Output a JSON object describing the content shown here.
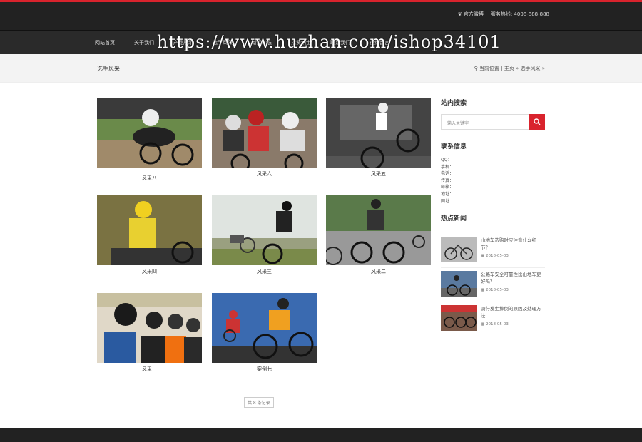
{
  "topbar": {
    "weibo": "官方微博",
    "hotline": "服务热线: 4008-888-888"
  },
  "nav": {
    "items": [
      "网站首页",
      "关于我们",
      "产品展示",
      "选手风采",
      "新闻动态",
      "招贤纳士",
      "联系我们",
      "在线留言"
    ]
  },
  "watermark": "https://www.huzhan.com/ishop34101",
  "titlebar": {
    "page_title": "选手风采",
    "location_label": "当前位置",
    "breadcrumb": "主页 » 选手风采 »"
  },
  "gallery": [
    {
      "caption": "风采八"
    },
    {
      "caption": "风采六"
    },
    {
      "caption": "风采五"
    },
    {
      "caption": "风采四"
    },
    {
      "caption": "风采三"
    },
    {
      "caption": "风采二"
    },
    {
      "caption": "风采一"
    },
    {
      "caption": "案例七"
    }
  ],
  "pagination": {
    "text": "共 8 条记录"
  },
  "sidebar": {
    "search_title": "站内搜索",
    "search_placeholder": "输入关键字",
    "contact_title": "联系信息",
    "contact_lines": [
      "QQ：",
      "手机：",
      "电话：",
      "传真：",
      "邮箱：",
      "地址：",
      "网址："
    ],
    "news_title": "热点新闻",
    "news": [
      {
        "title": "山地车选购时应注意什么细节？",
        "date": "2018-05-03"
      },
      {
        "title": "公路车安全可靠性比山地车更好吗？",
        "date": "2018-05-03"
      },
      {
        "title": "骑行发生摔倒的原因及处理方法",
        "date": "2018-05-03"
      }
    ]
  },
  "colors": {
    "accent": "#d9232d",
    "header_bg": "#222222",
    "nav_bg": "#2a2a2a"
  }
}
